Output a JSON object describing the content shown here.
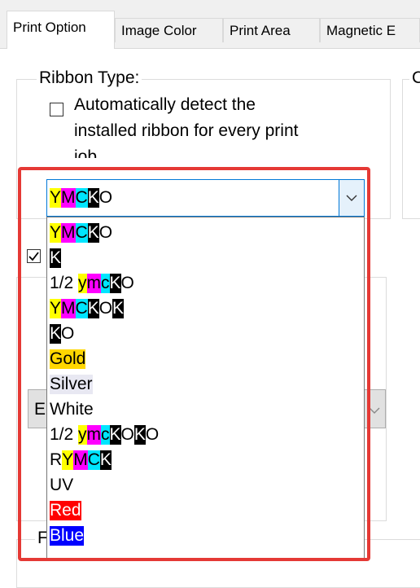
{
  "tabs": [
    {
      "label": "Print Option"
    },
    {
      "label": "Image Color"
    },
    {
      "label": "Print Area"
    },
    {
      "label": "Magnetic E"
    }
  ],
  "ribbon": {
    "group_title": "Ribbon Type:",
    "auto_detect_label_1": "Automatically detect the",
    "auto_detect_label_2": "installed ribbon for every print",
    "auto_detect_label_3": "job",
    "selected_value": "YMCKO"
  },
  "options": [
    {
      "label": "YMCKO"
    },
    {
      "label": "K"
    },
    {
      "label": "1/2 ymcKO"
    },
    {
      "label": "YMCKOK"
    },
    {
      "label": "KO"
    },
    {
      "label": "Gold"
    },
    {
      "label": "Silver"
    },
    {
      "label": "White"
    },
    {
      "label": "1/2 ymcKOKO"
    },
    {
      "label": "RYMCK"
    },
    {
      "label": "UV"
    },
    {
      "label": "Red"
    },
    {
      "label": "Blue"
    }
  ],
  "partial": {
    "right_group_initial": "C",
    "left_letter_e": "E",
    "left_letter_f": "F"
  },
  "icons": {
    "combo_arrow": "chevron-down-icon",
    "checkmark": "checkmark-icon"
  },
  "colors": {
    "highlight": "#e53935",
    "yellow": "#ffff00",
    "magenta": "#ff00ff",
    "cyan": "#00e5ff",
    "black": "#000000",
    "gold": "#ffd700",
    "silver": "#e8e8f2",
    "red": "#ff0000",
    "blue": "#0000ff"
  }
}
